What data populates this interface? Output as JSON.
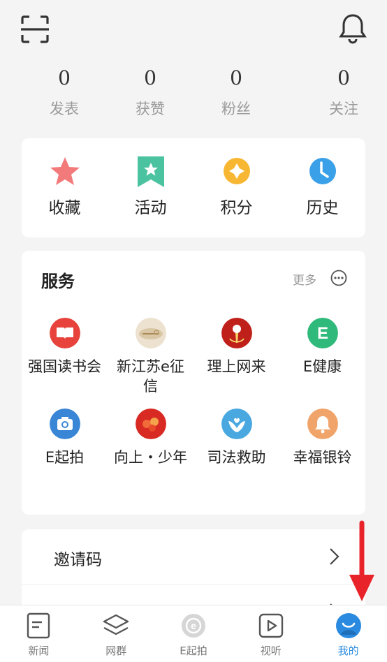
{
  "header": {
    "scan_icon": "scan-icon",
    "bell_icon": "bell-icon"
  },
  "stats": [
    {
      "value": "0",
      "label": "发表"
    },
    {
      "value": "0",
      "label": "获赞"
    },
    {
      "value": "0",
      "label": "粉丝"
    },
    {
      "value": "0",
      "label": "关注"
    }
  ],
  "quick": [
    {
      "label": "收藏",
      "icon": "star-icon",
      "color": "#f26b6b"
    },
    {
      "label": "活动",
      "icon": "bookmark-star-icon",
      "color": "#4cc3a0"
    },
    {
      "label": "积分",
      "icon": "points-icon",
      "color": "#f7b733"
    },
    {
      "label": "历史",
      "icon": "clock-icon",
      "color": "#3aa0e8"
    }
  ],
  "services": {
    "title": "服务",
    "more": "更多",
    "items": [
      {
        "label": "强国读书会",
        "icon": "book-icon",
        "color": "#e8423c"
      },
      {
        "label": "新江苏e征信",
        "icon": "credit-icon",
        "color": "#d9c7a6"
      },
      {
        "label": "理上网来",
        "icon": "microphone-icon",
        "color": "#c0201a"
      },
      {
        "label": "E健康",
        "icon": "e-health-icon",
        "color": "#2fb97a"
      },
      {
        "label": "E起拍",
        "icon": "camera-icon",
        "color": "#3a86d6"
      },
      {
        "label": "向上・少年",
        "icon": "youth-icon",
        "color": "#d82a22"
      },
      {
        "label": "司法救助",
        "icon": "hands-heart-icon",
        "color": "#4aa8e0"
      },
      {
        "label": "幸福银铃",
        "icon": "silver-bell-icon",
        "color": "#f0a46a"
      }
    ]
  },
  "list": [
    {
      "label": "邀请码"
    },
    {
      "label": ""
    }
  ],
  "tabs": [
    {
      "label": "新闻",
      "icon": "news-icon"
    },
    {
      "label": "网群",
      "icon": "layers-icon"
    },
    {
      "label": "E起拍",
      "icon": "e-camera-icon"
    },
    {
      "label": "视听",
      "icon": "play-icon"
    },
    {
      "label": "我的",
      "icon": "profile-icon",
      "active": true,
      "color": "#2a8ae0"
    }
  ],
  "annotation": {
    "arrow_color": "#e8232a"
  }
}
